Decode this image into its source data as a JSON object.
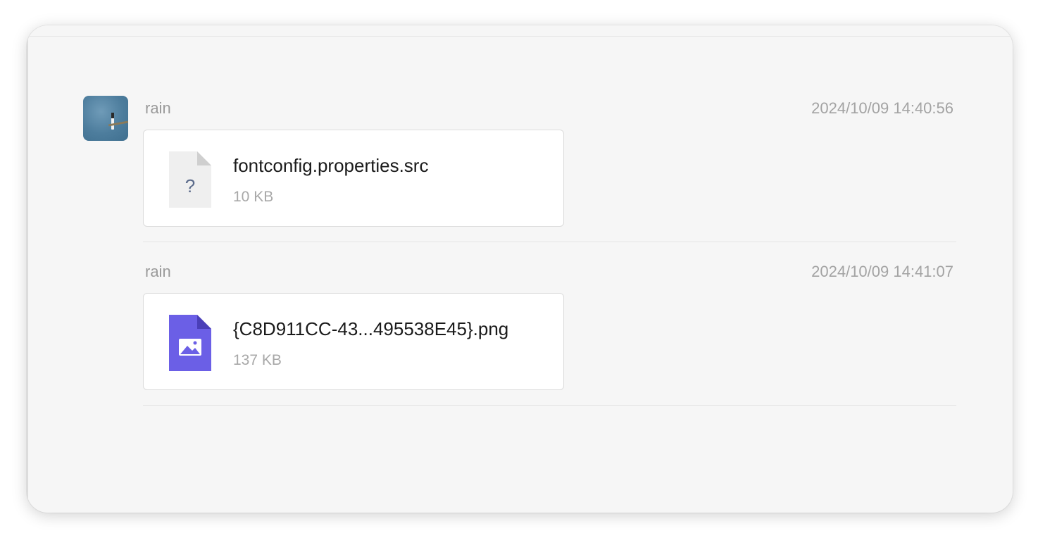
{
  "messages": [
    {
      "sender": "rain",
      "timestamp": "2024/10/09 14:40:56",
      "file": {
        "name": "fontconfig.properties.src",
        "size": "10 KB",
        "icon": "unknown-file-icon",
        "icon_glyph": "?"
      }
    },
    {
      "sender": "rain",
      "timestamp": "2024/10/09 14:41:07",
      "file": {
        "name": "{C8D911CC-43...495538E45}.png",
        "size": "137 KB",
        "icon": "image-file-icon"
      }
    }
  ],
  "colors": {
    "image_file_icon": "#6b5fe6",
    "unknown_file_icon": "#efefef"
  }
}
